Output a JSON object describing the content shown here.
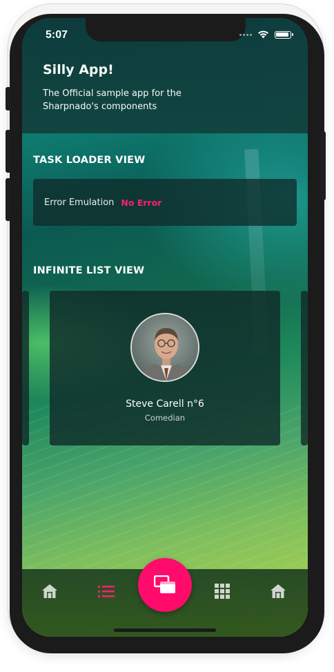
{
  "status_bar": {
    "time": "5:07"
  },
  "header": {
    "title": "Silly App!",
    "subtitle": "The Official sample app for the Sharpnado's components"
  },
  "task_loader": {
    "section_title": "TASK LOADER VIEW",
    "label": "Error Emulation",
    "value": "No Error"
  },
  "infinite_list": {
    "section_title": "INFINITE LIST VIEW",
    "card": {
      "name": "Steve Carell n°6",
      "role": "Comedian"
    }
  },
  "tabbar": {
    "items": [
      "home-icon",
      "list-icon",
      "tabs-icon",
      "grid-icon",
      "home-icon"
    ],
    "selected_index": 1
  },
  "colors": {
    "accent": "#ff0b6b",
    "header_bg": "#0f3b3c",
    "card_bg": "#102c2a",
    "icon_inactive": "#cfd6cf"
  }
}
